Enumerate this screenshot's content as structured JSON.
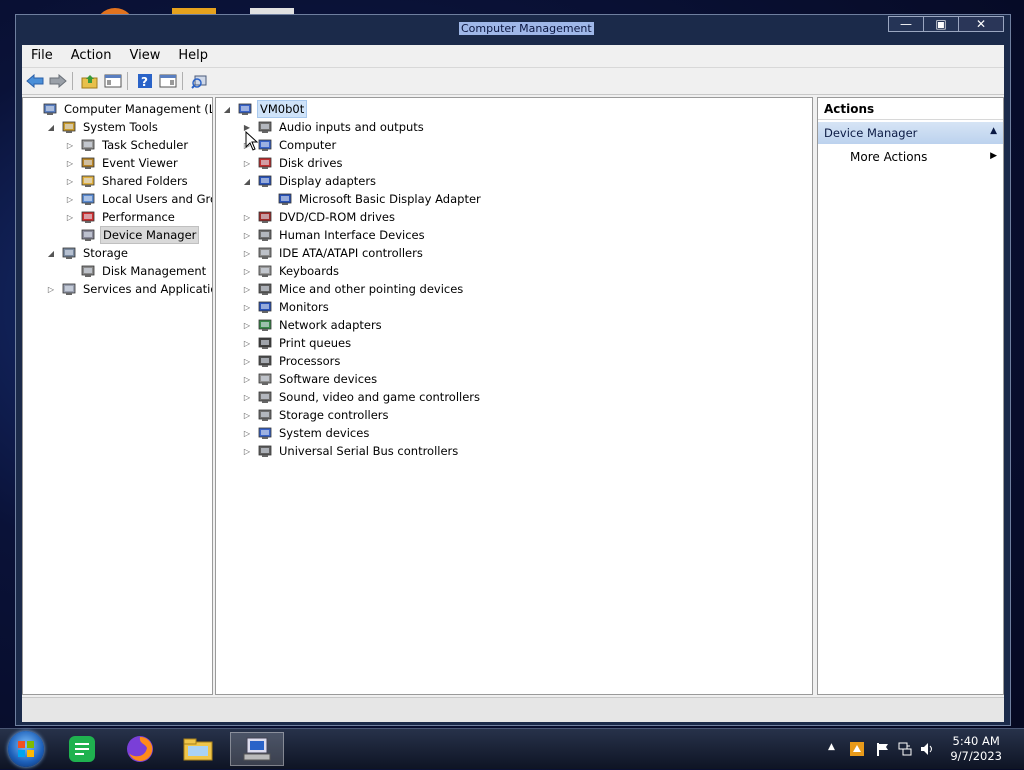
{
  "window": {
    "title": "Computer Management",
    "minimize": "—",
    "maximize": "▣",
    "close": "✕"
  },
  "menu": [
    "File",
    "Action",
    "View",
    "Help"
  ],
  "left_tree": [
    {
      "label": "Computer Management (Local)",
      "level": 0,
      "expander": "",
      "icon": "computer-management-icon"
    },
    {
      "label": "System Tools",
      "level": 1,
      "expander": "◢",
      "icon": "system-tools-icon"
    },
    {
      "label": "Task Scheduler",
      "level": 2,
      "expander": "▷",
      "icon": "task-scheduler-icon"
    },
    {
      "label": "Event Viewer",
      "level": 2,
      "expander": "▷",
      "icon": "event-viewer-icon"
    },
    {
      "label": "Shared Folders",
      "level": 2,
      "expander": "▷",
      "icon": "shared-folders-icon"
    },
    {
      "label": "Local Users and Groups",
      "level": 2,
      "expander": "▷",
      "icon": "local-users-icon"
    },
    {
      "label": "Performance",
      "level": 2,
      "expander": "▷",
      "icon": "performance-icon"
    },
    {
      "label": "Device Manager",
      "level": 2,
      "expander": "",
      "icon": "device-manager-icon",
      "selected": true
    },
    {
      "label": "Storage",
      "level": 1,
      "expander": "◢",
      "icon": "storage-icon"
    },
    {
      "label": "Disk Management",
      "level": 2,
      "expander": "",
      "icon": "disk-management-icon"
    },
    {
      "label": "Services and Applications",
      "level": 1,
      "expander": "▷",
      "icon": "services-icon"
    }
  ],
  "device_tree": {
    "root": "VM0b0t",
    "items": [
      {
        "label": "Audio inputs and outputs",
        "level": 1,
        "expander": "▶",
        "icon": "speaker-icon"
      },
      {
        "label": "Computer",
        "level": 1,
        "expander": "▷",
        "icon": "computer-icon"
      },
      {
        "label": "Disk drives",
        "level": 1,
        "expander": "▷",
        "icon": "disk-drive-icon"
      },
      {
        "label": "Display adapters",
        "level": 1,
        "expander": "◢",
        "icon": "display-adapter-icon"
      },
      {
        "label": "Microsoft Basic Display Adapter",
        "level": 2,
        "expander": "",
        "icon": "display-adapter-icon"
      },
      {
        "label": "DVD/CD-ROM drives",
        "level": 1,
        "expander": "▷",
        "icon": "dvd-icon"
      },
      {
        "label": "Human Interface Devices",
        "level": 1,
        "expander": "▷",
        "icon": "hid-icon"
      },
      {
        "label": "IDE ATA/ATAPI controllers",
        "level": 1,
        "expander": "▷",
        "icon": "ide-controller-icon"
      },
      {
        "label": "Keyboards",
        "level": 1,
        "expander": "▷",
        "icon": "keyboard-icon"
      },
      {
        "label": "Mice and other pointing devices",
        "level": 1,
        "expander": "▷",
        "icon": "mouse-icon"
      },
      {
        "label": "Monitors",
        "level": 1,
        "expander": "▷",
        "icon": "monitor-icon"
      },
      {
        "label": "Network adapters",
        "level": 1,
        "expander": "▷",
        "icon": "network-adapter-icon"
      },
      {
        "label": "Print queues",
        "level": 1,
        "expander": "▷",
        "icon": "printer-icon"
      },
      {
        "label": "Processors",
        "level": 1,
        "expander": "▷",
        "icon": "processor-icon"
      },
      {
        "label": "Software devices",
        "level": 1,
        "expander": "▷",
        "icon": "software-device-icon"
      },
      {
        "label": "Sound, video and game controllers",
        "level": 1,
        "expander": "▷",
        "icon": "sound-controller-icon"
      },
      {
        "label": "Storage controllers",
        "level": 1,
        "expander": "▷",
        "icon": "storage-controller-icon"
      },
      {
        "label": "System devices",
        "level": 1,
        "expander": "▷",
        "icon": "system-devices-icon"
      },
      {
        "label": "Universal Serial Bus controllers",
        "level": 1,
        "expander": "▷",
        "icon": "usb-icon"
      }
    ]
  },
  "actions": {
    "header": "Actions",
    "section": "Device Manager",
    "section_arrow": "▲",
    "item": "More Actions",
    "item_arrow": "▶"
  },
  "taskbar": {
    "time": "5:40 AM",
    "date": "9/7/2023"
  }
}
